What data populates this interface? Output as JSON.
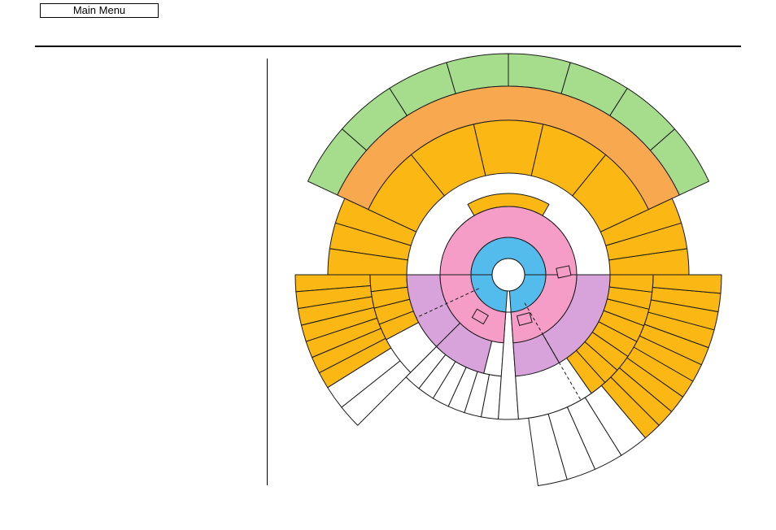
{
  "header": {
    "main_menu_label": "Main Menu"
  },
  "colors": {
    "blue": "#54BCEC",
    "pink": "#F59CC7",
    "lavender": "#D7A3DA",
    "yellow_orange": "#FBB714",
    "orange": "#F8A84E",
    "green": "#A5DD8D",
    "white": "#FFFFFF",
    "stroke": "#1A1A1A"
  },
  "diagram": {
    "shape": "radial-sectors",
    "ring_fills": [
      {
        "ring": "center",
        "color": "white"
      },
      {
        "ring": 1,
        "color": "blue"
      },
      {
        "ring": 2,
        "color": "pink"
      },
      {
        "ring": 3,
        "color": "yellow_orange / lavender / white"
      },
      {
        "ring": 4,
        "color": "yellow_orange / white"
      },
      {
        "ring": 5,
        "color": "orange / yellow_orange / white"
      },
      {
        "ring": 6,
        "color": "green"
      }
    ]
  }
}
